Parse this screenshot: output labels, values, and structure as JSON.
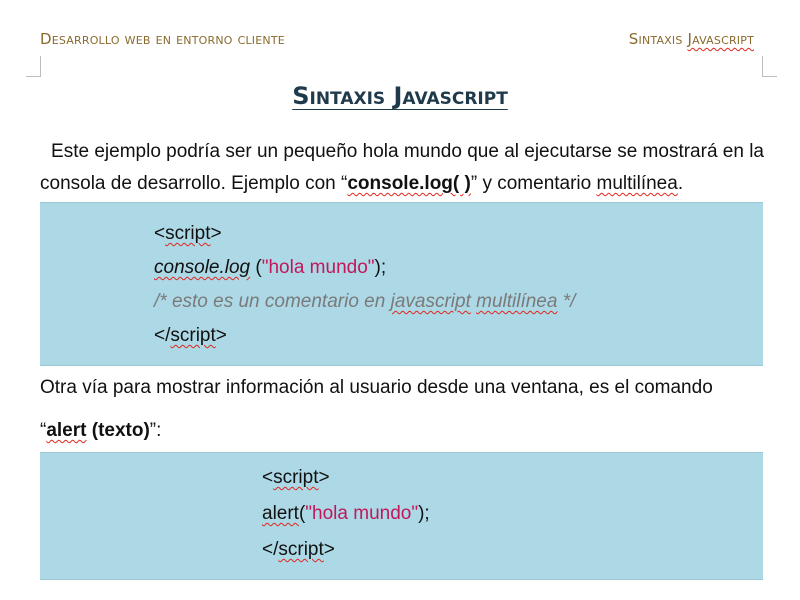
{
  "header": {
    "left": "Desarrollo web en entorno cliente",
    "right_prefix": "Sintaxis ",
    "right_word": "Javascript"
  },
  "title": "Sintaxis Javascript",
  "paragraph1": {
    "line1": "Este ejemplo podría ser un pequeño hola mundo que al ejecutarse se mostrará en la",
    "line2_pre": "consola de desarrollo.  Ejemplo con “",
    "line2_code": "console.log( )",
    "line2_mid": "” y comentario ",
    "line2_word": "multilínea",
    "line2_end": "."
  },
  "code_block_1": {
    "open_lt": "<",
    "open_tag": "script",
    "open_gt": ">",
    "call": "console.log",
    "call_paren_open": " (",
    "string": "\"hola mundo\"",
    "call_paren_close": ");",
    "comment_start": "/* esto es un comentario en ",
    "comment_w1": "javascript",
    "comment_space": " ",
    "comment_w2": "multilínea",
    "comment_end": " */",
    "close_lt": "</",
    "close_tag": "script",
    "close_gt": ">"
  },
  "paragraph2": {
    "line1": "Otra vía para mostrar información al usuario desde una ventana, es el comando",
    "line2_open": "“",
    "line2_alert": "alert",
    "line2_rest": " (texto)",
    "line2_end": "”:"
  },
  "code_block_2": {
    "open_lt": "<",
    "open_tag": "script",
    "open_gt": ">",
    "call": "alert",
    "call_paren_open": "(",
    "string": "\"hola mundo\"",
    "call_paren_close": ");",
    "close_lt": "</",
    "close_tag": "script",
    "close_gt": ">"
  },
  "colors": {
    "header": "#8a6a2c",
    "title": "#1f3a4a",
    "code_background": "#add8e6",
    "string": "#c2185b",
    "comment": "#7a7a7a",
    "spellcheck": "#e0261e"
  }
}
